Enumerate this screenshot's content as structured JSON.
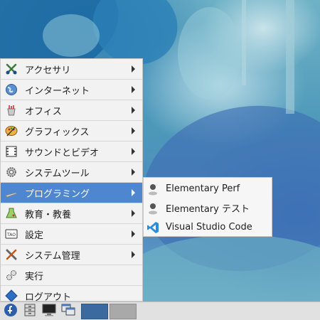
{
  "menu": {
    "items": [
      {
        "label": "アクセサリ",
        "icon": "accessories-icon",
        "has_submenu": true
      },
      {
        "label": "インターネット",
        "icon": "internet-globe-icon",
        "has_submenu": true
      },
      {
        "label": "オフィス",
        "icon": "office-icon",
        "has_submenu": true
      },
      {
        "label": "グラフィックス",
        "icon": "graphics-palette-icon",
        "has_submenu": true
      },
      {
        "label": "サウンドとビデオ",
        "icon": "sound-video-icon",
        "has_submenu": true
      },
      {
        "label": "システムツール",
        "icon": "system-tools-gear-icon",
        "has_submenu": true
      },
      {
        "label": "プログラミング",
        "icon": "programming-icon",
        "has_submenu": true,
        "active": true
      },
      {
        "label": "教育・教養",
        "icon": "education-icon",
        "has_submenu": true
      },
      {
        "label": "設定",
        "icon": "settings-icon",
        "has_submenu": true
      },
      {
        "label": "システム管理",
        "icon": "system-admin-tools-icon",
        "has_submenu": true
      },
      {
        "label": "実行",
        "icon": "run-gears-icon",
        "has_submenu": false
      },
      {
        "label": "ログアウト",
        "icon": "logout-icon",
        "has_submenu": false
      }
    ]
  },
  "submenu": {
    "items": [
      {
        "label": "Elementary Perf",
        "icon": "elementary-app-icon"
      },
      {
        "label": "Elementary テスト",
        "icon": "elementary-app-icon"
      },
      {
        "label": "Visual Studio Code",
        "icon": "vscode-icon"
      }
    ]
  },
  "taskbar": {
    "buttons": [
      "fedora-logo-icon",
      "file-cabinet-icon",
      "terminal-monitor-icon",
      "windows-switcher-icon"
    ],
    "workspaces": [
      "workspace-1",
      "workspace-2"
    ]
  },
  "colors": {
    "accent": "#4e86cf",
    "menu_bg": "#f2f2f2",
    "taskbar_bg": "#e1e1e1"
  }
}
